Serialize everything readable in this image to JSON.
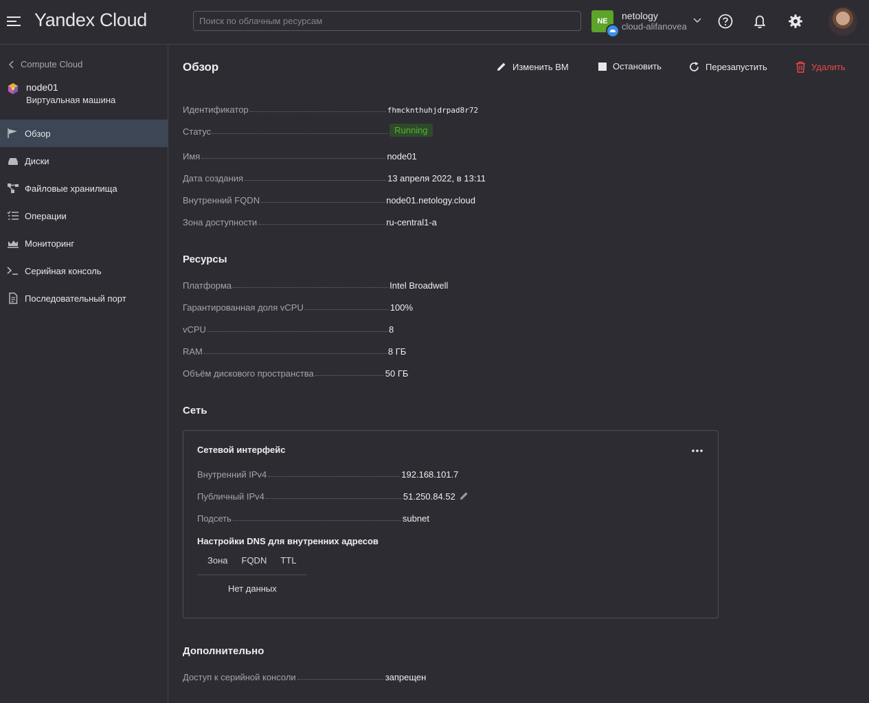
{
  "header": {
    "logo": "Yandex Cloud",
    "search_placeholder": "Поиск по облачным ресурсам",
    "account_badge": "NE",
    "account_name": "netology",
    "account_cloud": "cloud-alifanovea"
  },
  "sidebar": {
    "back_label": "Compute Cloud",
    "vm_name": "node01",
    "vm_type": "Виртуальная машина",
    "items": [
      {
        "label": "Обзор",
        "icon": "flag-icon"
      },
      {
        "label": "Диски",
        "icon": "disk-icon"
      },
      {
        "label": "Файловые хранилища",
        "icon": "file-storage-icon"
      },
      {
        "label": "Операции",
        "icon": "operations-list-icon"
      },
      {
        "label": "Мониторинг",
        "icon": "monitoring-icon"
      },
      {
        "label": "Серийная консоль",
        "icon": "terminal-icon"
      },
      {
        "label": "Последовательный порт",
        "icon": "document-icon"
      }
    ]
  },
  "main": {
    "title": "Обзор",
    "actions": {
      "edit": "Изменить ВМ",
      "stop": "Остановить",
      "restart": "Перезапустить",
      "delete": "Удалить"
    },
    "overview": [
      {
        "label": "Идентификатор",
        "value": "fhmcknthuhjdrpad8r72"
      },
      {
        "label": "Статус",
        "value": "Running"
      },
      {
        "label": "Имя",
        "value": "node01"
      },
      {
        "label": "Дата создания",
        "value": "13 апреля 2022, в 13:11"
      },
      {
        "label": "Внутренний FQDN",
        "value": "node01.netology.cloud"
      },
      {
        "label": "Зона доступности",
        "value": "ru-central1-a"
      }
    ],
    "resources_title": "Ресурсы",
    "resources": [
      {
        "label": "Платформа",
        "value": "Intel Broadwell"
      },
      {
        "label": "Гарантированная доля vCPU",
        "value": "100%"
      },
      {
        "label": "vCPU",
        "value": "8"
      },
      {
        "label": "RAM",
        "value": "8 ГБ"
      },
      {
        "label": "Объём дискового пространства",
        "value": "50 ГБ"
      }
    ],
    "network_title": "Сеть",
    "network": {
      "card_title": "Сетевой интерфейс",
      "rows": [
        {
          "label": "Внутренний IPv4",
          "value": "192.168.101.7"
        },
        {
          "label": "Публичный IPv4",
          "value": "51.250.84.52"
        },
        {
          "label": "Подсеть",
          "value": "subnet"
        }
      ],
      "dns_title": "Настройки DNS для внутренних адресов",
      "dns_columns": [
        "Зона",
        "FQDN",
        "TTL"
      ],
      "dns_empty": "Нет данных"
    },
    "extra_title": "Дополнительно",
    "extra": [
      {
        "label": "Доступ к серийной консоли",
        "value": "запрещен"
      }
    ]
  },
  "colors": {
    "background": "#2d2c33",
    "active_nav": "#3d4654",
    "status_running": "#52b234",
    "danger": "#e8484a",
    "link": "#4a9ef0",
    "account_badge": "#5da42a"
  }
}
